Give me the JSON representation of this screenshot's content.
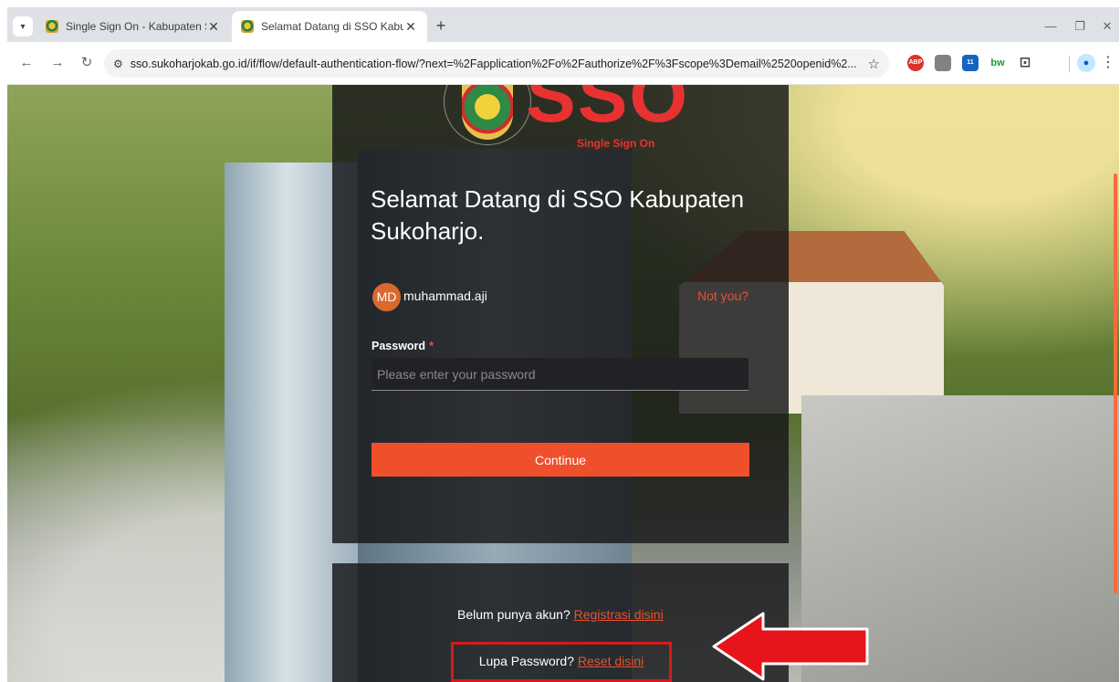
{
  "browser": {
    "tabs": [
      {
        "title": "Single Sign On - Kabupaten Sul",
        "close": "✕",
        "active": false
      },
      {
        "title": "Selamat Datang di SSO Kabupa",
        "close": "✕",
        "active": true
      }
    ],
    "new_tab": "+",
    "url": "sso.sukoharjokab.go.id/if/flow/default-authentication-flow/?next=%2Fapplication%2Fo%2Fauthorize%2F%3Fscope%3Demail%2520openid%2...",
    "extensions": [
      {
        "label": "ABP",
        "color": "#d8342c"
      },
      {
        "label": "",
        "color": "#7f8386"
      },
      {
        "label": "11",
        "color": "#1565c0"
      },
      {
        "label": "bw",
        "color": "#1b9b3c"
      }
    ]
  },
  "page": {
    "logo_text": "SSO",
    "logo_subtitle": "Single Sign On",
    "heading": "Selamat Datang di SSO Kabupaten Sukoharjo.",
    "user": {
      "initials": "MD",
      "username": "muhammad.aji",
      "not_you": "Not you?"
    },
    "password": {
      "label": "Password",
      "required_mark": "*",
      "placeholder": "Please enter your password"
    },
    "continue_label": "Continue",
    "register": {
      "text": "Belum punya akun?",
      "link": "Registrasi disini"
    },
    "reset": {
      "text": "Lupa Password?",
      "link": "Reset disini"
    }
  },
  "colors": {
    "accent": "#f04f2c",
    "highlight_box": "#d61a1a",
    "panel": "#161619"
  }
}
